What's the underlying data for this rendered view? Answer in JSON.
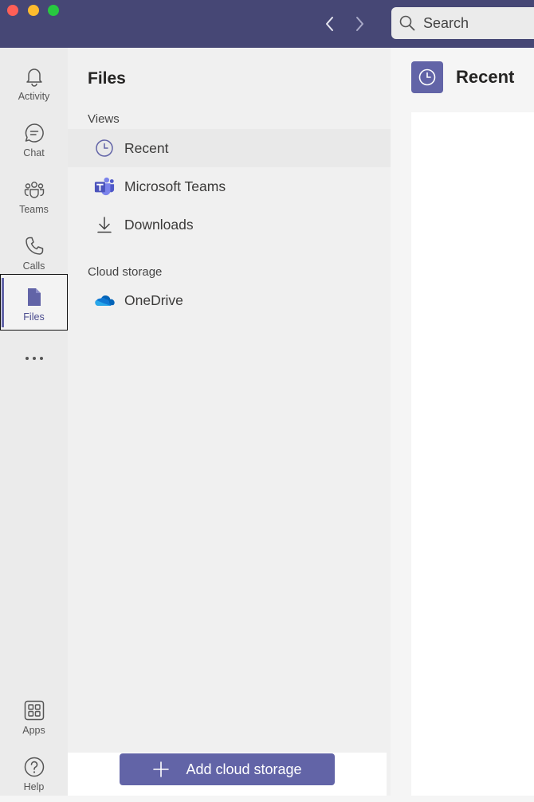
{
  "window": {
    "search_placeholder": "Search"
  },
  "rail": {
    "items": [
      {
        "label": "Activity",
        "icon": "bell-icon"
      },
      {
        "label": "Chat",
        "icon": "chat-icon"
      },
      {
        "label": "Teams",
        "icon": "teams-icon"
      },
      {
        "label": "Calls",
        "icon": "phone-icon"
      },
      {
        "label": "Files",
        "icon": "file-icon",
        "active": true
      },
      {
        "label": "Apps",
        "icon": "apps-icon"
      },
      {
        "label": "Help",
        "icon": "help-icon"
      }
    ]
  },
  "files_panel": {
    "title": "Files",
    "views_label": "Views",
    "views": [
      {
        "label": "Recent",
        "icon": "clock-icon",
        "selected": true
      },
      {
        "label": "Microsoft Teams",
        "icon": "microsoft-teams-icon"
      },
      {
        "label": "Downloads",
        "icon": "download-icon"
      }
    ],
    "cloud_label": "Cloud storage",
    "cloud": [
      {
        "label": "OneDrive",
        "icon": "onedrive-icon"
      }
    ],
    "add_button": "Add cloud storage"
  },
  "main": {
    "title": "Recent"
  },
  "colors": {
    "titlebar": "#464775",
    "accent": "#6264a7",
    "rail_bg": "#ebebeb",
    "panel_bg": "#f0f0f0"
  }
}
